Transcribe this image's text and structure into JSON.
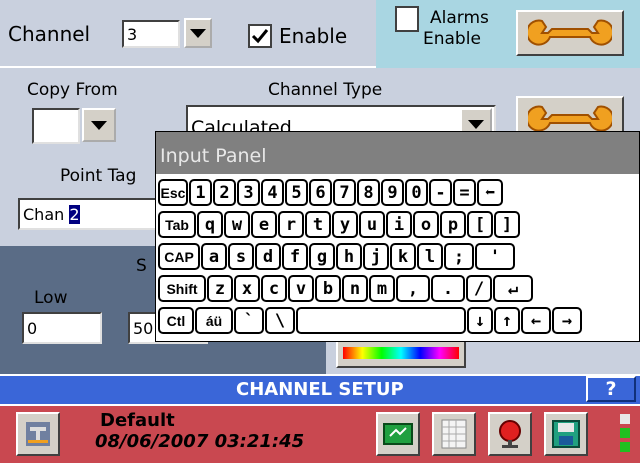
{
  "top": {
    "channel_label": "Channel",
    "channel_value": "3",
    "enable_label": "Enable",
    "enable_checked": true,
    "alarms_label_line1": "Alarms",
    "alarms_label_line2": "Enable",
    "alarms_checked": false
  },
  "settings": {
    "copy_from_label": "Copy From",
    "copy_from_value": "",
    "channel_type_label": "Channel Type",
    "channel_type_value": "Calculated",
    "point_tag_label": "Point Tag",
    "point_tag_prefix": "Chan ",
    "point_tag_selected": "2",
    "scale_heading_partial": "S",
    "low_label": "Low",
    "low_value": "0",
    "high_value_partial": "50"
  },
  "input_panel": {
    "title": "Input Panel",
    "rows": [
      [
        "Esc",
        "1",
        "2",
        "3",
        "4",
        "5",
        "6",
        "7",
        "8",
        "9",
        "0",
        "-",
        "=",
        "⬅"
      ],
      [
        "Tab",
        "q",
        "w",
        "e",
        "r",
        "t",
        "y",
        "u",
        "i",
        "o",
        "p",
        "[",
        "]"
      ],
      [
        "CAP",
        "a",
        "s",
        "d",
        "f",
        "g",
        "h",
        "j",
        "k",
        "l",
        ";",
        "'"
      ],
      [
        "Shift",
        "z",
        "x",
        "c",
        "v",
        "b",
        "n",
        "m",
        ",",
        ".",
        "/",
        "↵"
      ],
      [
        "Ctl",
        "áü",
        "`",
        "\\",
        " ",
        "↓",
        "↑",
        "←",
        "→"
      ]
    ]
  },
  "status": {
    "heading": "CHANNEL SETUP",
    "help_label": "?",
    "profile_name": "Default",
    "datetime": "08/06/2007 03:21:45"
  },
  "colors": {
    "heading_bar": "#3a66d8",
    "status_bar": "#c94850",
    "panel_bg": "#c9d0de",
    "alarms_bg": "#a9d6e2",
    "scale_bg": "#5a6c86"
  }
}
